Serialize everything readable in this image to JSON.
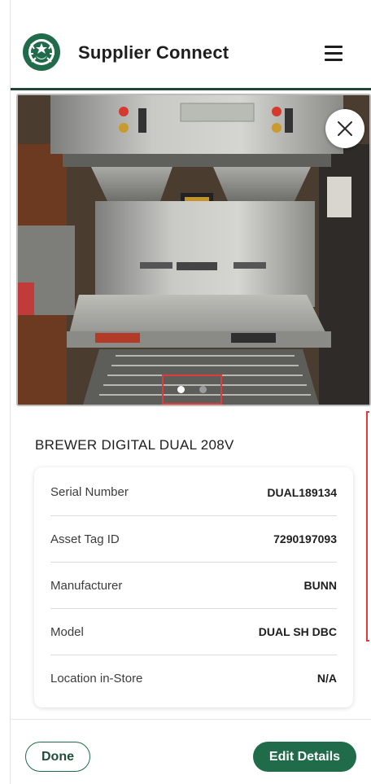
{
  "header": {
    "title": "Supplier Connect",
    "logo_icon": "starbucks-siren-logo",
    "menu_icon": "hamburger-menu-icon"
  },
  "photo": {
    "subject": "brewer-photo",
    "close_icon": "close-icon",
    "slide_count": 2,
    "active_slide": 1
  },
  "asset": {
    "name": "BREWER DIGITAL DUAL 208V",
    "details": [
      {
        "label": "Serial Number",
        "value": "DUAL189134"
      },
      {
        "label": "Asset Tag ID",
        "value": "7290197093"
      },
      {
        "label": "Manufacturer",
        "value": "BUNN"
      },
      {
        "label": "Model",
        "value": "DUAL SH DBC"
      },
      {
        "label": "Location in-Store",
        "value": "N/A"
      }
    ]
  },
  "footer": {
    "done_label": "Done",
    "edit_label": "Edit Details"
  },
  "colors": {
    "brand_green": "#1f6b4a",
    "header_rule": "#1f4438",
    "annotation_red": "#e03a3a"
  }
}
